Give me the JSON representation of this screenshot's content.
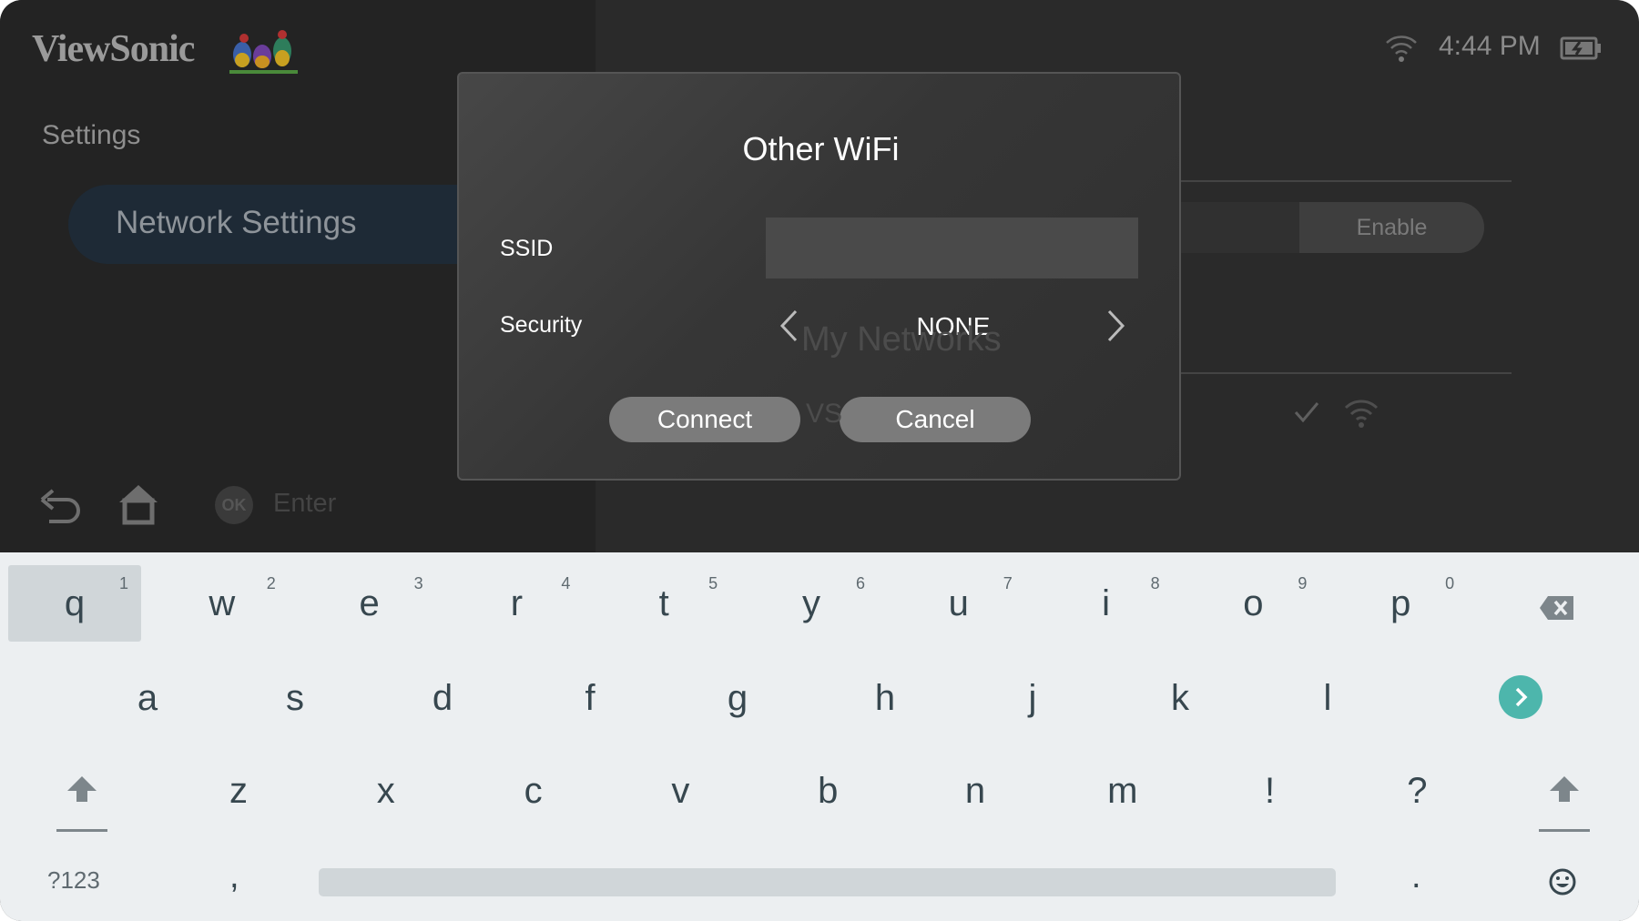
{
  "brand": {
    "logo_text": "ViewSonic"
  },
  "status": {
    "time": "4:44 PM",
    "wifi_icon": "wifi-icon",
    "battery_icon": "battery-charging-icon"
  },
  "sidebar": {
    "title": "Settings",
    "selected_item": "Network Settings"
  },
  "footer": {
    "ok_label": "OK",
    "enter_label": "Enter"
  },
  "background": {
    "enable_label": "Enable",
    "my_networks": "My Networks",
    "network_partial": "VS"
  },
  "dialog": {
    "title": "Other WiFi",
    "ssid_label": "SSID",
    "ssid_value": "",
    "security_label": "Security",
    "security_value": "NONE",
    "connect_label": "Connect",
    "cancel_label": "Cancel"
  },
  "keyboard": {
    "accent": "#4db6ac",
    "row1": [
      {
        "k": "q",
        "h": "1"
      },
      {
        "k": "w",
        "h": "2"
      },
      {
        "k": "e",
        "h": "3"
      },
      {
        "k": "r",
        "h": "4"
      },
      {
        "k": "t",
        "h": "5"
      },
      {
        "k": "y",
        "h": "6"
      },
      {
        "k": "u",
        "h": "7"
      },
      {
        "k": "i",
        "h": "8"
      },
      {
        "k": "o",
        "h": "9"
      },
      {
        "k": "p",
        "h": "0"
      }
    ],
    "row2": [
      "a",
      "s",
      "d",
      "f",
      "g",
      "h",
      "j",
      "k",
      "l"
    ],
    "row3": [
      "z",
      "x",
      "c",
      "v",
      "b",
      "n",
      "m",
      "!",
      "?"
    ],
    "symbols_label": "?123",
    "comma": ",",
    "period": ".",
    "highlighted": "q"
  }
}
